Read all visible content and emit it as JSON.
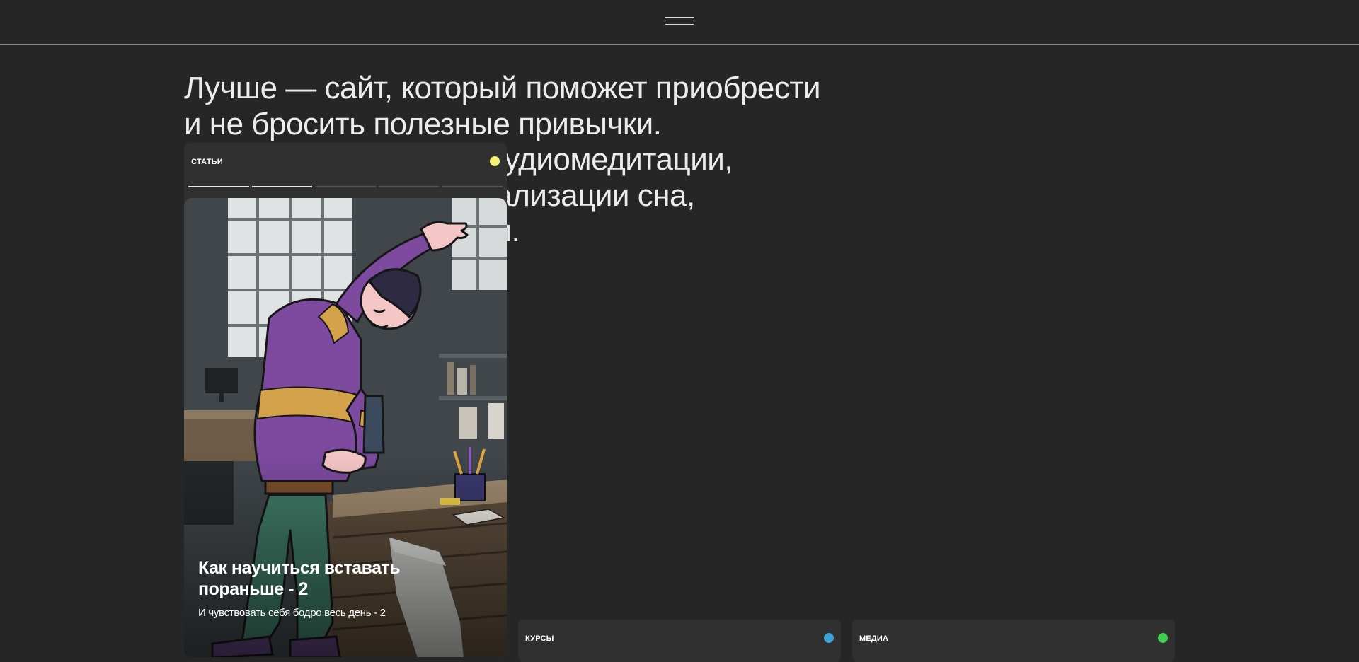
{
  "header": {
    "menu_icon": "hamburger-icon"
  },
  "intro": {
    "lines": [
      "Лучше — сайт, который поможет приобрести",
      "и не бросить полезные привычки.",
      "Тут есть тренировки, аудиомедитации,",
      "упражнения для нормализации сна,",
      "практики осознанности."
    ]
  },
  "articles": {
    "title": "СТАТЬИ",
    "dot_color": "#f5f078",
    "progress": [
      1.0,
      1.0,
      0.0,
      0.0,
      0.0
    ],
    "card": {
      "title": "Как научиться вставать пораньше - 2",
      "subtitle": "И чувствовать себя бодро весь день - 2"
    }
  },
  "courses": {
    "title": "КУРСЫ",
    "dot_color": "#3ea0d8"
  },
  "media": {
    "title": "МЕДИА",
    "dot_color": "#3ecf4e"
  }
}
